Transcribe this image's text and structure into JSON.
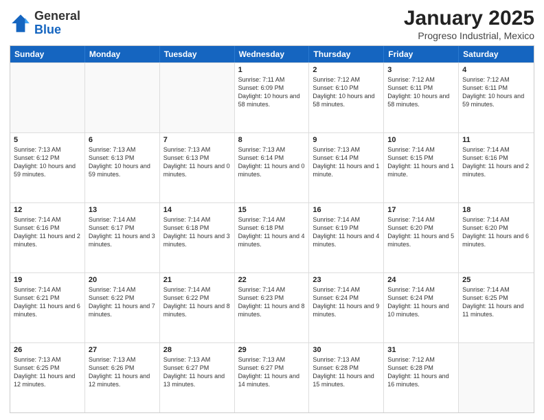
{
  "logo": {
    "line1": "General",
    "line2": "Blue"
  },
  "title": "January 2025",
  "subtitle": "Progreso Industrial, Mexico",
  "header_days": [
    "Sunday",
    "Monday",
    "Tuesday",
    "Wednesday",
    "Thursday",
    "Friday",
    "Saturday"
  ],
  "weeks": [
    [
      {
        "day": "",
        "sunrise": "",
        "sunset": "",
        "daylight": ""
      },
      {
        "day": "",
        "sunrise": "",
        "sunset": "",
        "daylight": ""
      },
      {
        "day": "",
        "sunrise": "",
        "sunset": "",
        "daylight": ""
      },
      {
        "day": "1",
        "sunrise": "Sunrise: 7:11 AM",
        "sunset": "Sunset: 6:09 PM",
        "daylight": "Daylight: 10 hours and 58 minutes."
      },
      {
        "day": "2",
        "sunrise": "Sunrise: 7:12 AM",
        "sunset": "Sunset: 6:10 PM",
        "daylight": "Daylight: 10 hours and 58 minutes."
      },
      {
        "day": "3",
        "sunrise": "Sunrise: 7:12 AM",
        "sunset": "Sunset: 6:11 PM",
        "daylight": "Daylight: 10 hours and 58 minutes."
      },
      {
        "day": "4",
        "sunrise": "Sunrise: 7:12 AM",
        "sunset": "Sunset: 6:11 PM",
        "daylight": "Daylight: 10 hours and 59 minutes."
      }
    ],
    [
      {
        "day": "5",
        "sunrise": "Sunrise: 7:13 AM",
        "sunset": "Sunset: 6:12 PM",
        "daylight": "Daylight: 10 hours and 59 minutes."
      },
      {
        "day": "6",
        "sunrise": "Sunrise: 7:13 AM",
        "sunset": "Sunset: 6:13 PM",
        "daylight": "Daylight: 10 hours and 59 minutes."
      },
      {
        "day": "7",
        "sunrise": "Sunrise: 7:13 AM",
        "sunset": "Sunset: 6:13 PM",
        "daylight": "Daylight: 11 hours and 0 minutes."
      },
      {
        "day": "8",
        "sunrise": "Sunrise: 7:13 AM",
        "sunset": "Sunset: 6:14 PM",
        "daylight": "Daylight: 11 hours and 0 minutes."
      },
      {
        "day": "9",
        "sunrise": "Sunrise: 7:13 AM",
        "sunset": "Sunset: 6:14 PM",
        "daylight": "Daylight: 11 hours and 1 minute."
      },
      {
        "day": "10",
        "sunrise": "Sunrise: 7:14 AM",
        "sunset": "Sunset: 6:15 PM",
        "daylight": "Daylight: 11 hours and 1 minute."
      },
      {
        "day": "11",
        "sunrise": "Sunrise: 7:14 AM",
        "sunset": "Sunset: 6:16 PM",
        "daylight": "Daylight: 11 hours and 2 minutes."
      }
    ],
    [
      {
        "day": "12",
        "sunrise": "Sunrise: 7:14 AM",
        "sunset": "Sunset: 6:16 PM",
        "daylight": "Daylight: 11 hours and 2 minutes."
      },
      {
        "day": "13",
        "sunrise": "Sunrise: 7:14 AM",
        "sunset": "Sunset: 6:17 PM",
        "daylight": "Daylight: 11 hours and 3 minutes."
      },
      {
        "day": "14",
        "sunrise": "Sunrise: 7:14 AM",
        "sunset": "Sunset: 6:18 PM",
        "daylight": "Daylight: 11 hours and 3 minutes."
      },
      {
        "day": "15",
        "sunrise": "Sunrise: 7:14 AM",
        "sunset": "Sunset: 6:18 PM",
        "daylight": "Daylight: 11 hours and 4 minutes."
      },
      {
        "day": "16",
        "sunrise": "Sunrise: 7:14 AM",
        "sunset": "Sunset: 6:19 PM",
        "daylight": "Daylight: 11 hours and 4 minutes."
      },
      {
        "day": "17",
        "sunrise": "Sunrise: 7:14 AM",
        "sunset": "Sunset: 6:20 PM",
        "daylight": "Daylight: 11 hours and 5 minutes."
      },
      {
        "day": "18",
        "sunrise": "Sunrise: 7:14 AM",
        "sunset": "Sunset: 6:20 PM",
        "daylight": "Daylight: 11 hours and 6 minutes."
      }
    ],
    [
      {
        "day": "19",
        "sunrise": "Sunrise: 7:14 AM",
        "sunset": "Sunset: 6:21 PM",
        "daylight": "Daylight: 11 hours and 6 minutes."
      },
      {
        "day": "20",
        "sunrise": "Sunrise: 7:14 AM",
        "sunset": "Sunset: 6:22 PM",
        "daylight": "Daylight: 11 hours and 7 minutes."
      },
      {
        "day": "21",
        "sunrise": "Sunrise: 7:14 AM",
        "sunset": "Sunset: 6:22 PM",
        "daylight": "Daylight: 11 hours and 8 minutes."
      },
      {
        "day": "22",
        "sunrise": "Sunrise: 7:14 AM",
        "sunset": "Sunset: 6:23 PM",
        "daylight": "Daylight: 11 hours and 8 minutes."
      },
      {
        "day": "23",
        "sunrise": "Sunrise: 7:14 AM",
        "sunset": "Sunset: 6:24 PM",
        "daylight": "Daylight: 11 hours and 9 minutes."
      },
      {
        "day": "24",
        "sunrise": "Sunrise: 7:14 AM",
        "sunset": "Sunset: 6:24 PM",
        "daylight": "Daylight: 11 hours and 10 minutes."
      },
      {
        "day": "25",
        "sunrise": "Sunrise: 7:14 AM",
        "sunset": "Sunset: 6:25 PM",
        "daylight": "Daylight: 11 hours and 11 minutes."
      }
    ],
    [
      {
        "day": "26",
        "sunrise": "Sunrise: 7:13 AM",
        "sunset": "Sunset: 6:25 PM",
        "daylight": "Daylight: 11 hours and 12 minutes."
      },
      {
        "day": "27",
        "sunrise": "Sunrise: 7:13 AM",
        "sunset": "Sunset: 6:26 PM",
        "daylight": "Daylight: 11 hours and 12 minutes."
      },
      {
        "day": "28",
        "sunrise": "Sunrise: 7:13 AM",
        "sunset": "Sunset: 6:27 PM",
        "daylight": "Daylight: 11 hours and 13 minutes."
      },
      {
        "day": "29",
        "sunrise": "Sunrise: 7:13 AM",
        "sunset": "Sunset: 6:27 PM",
        "daylight": "Daylight: 11 hours and 14 minutes."
      },
      {
        "day": "30",
        "sunrise": "Sunrise: 7:13 AM",
        "sunset": "Sunset: 6:28 PM",
        "daylight": "Daylight: 11 hours and 15 minutes."
      },
      {
        "day": "31",
        "sunrise": "Sunrise: 7:12 AM",
        "sunset": "Sunset: 6:28 PM",
        "daylight": "Daylight: 11 hours and 16 minutes."
      },
      {
        "day": "",
        "sunrise": "",
        "sunset": "",
        "daylight": ""
      }
    ]
  ]
}
